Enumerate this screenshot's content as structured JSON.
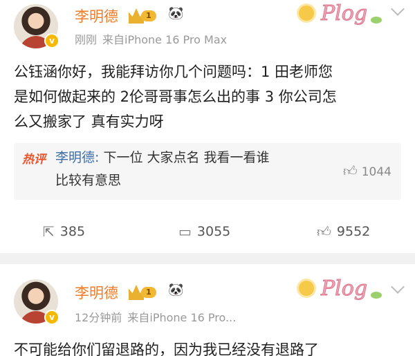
{
  "posts": [
    {
      "username": "李明德",
      "level": "1",
      "badge_icon": "panda-icon",
      "meta_time": "刚刚",
      "meta_source": "来自iPhone 16 Pro Max",
      "decoration": "Plog",
      "content": "公钰涵你好，我能拜访你几个问题吗：1 田老师您\n是如何做起来的 2伦哥哥事怎么出的事 3 你公司怎\n么又搬家了 真有实力呀",
      "hot_comment": {
        "label": "热评",
        "user": "李明德:",
        "text": " 下一位 大家点名 我看一看谁\n比较有意思",
        "likes": "1044"
      },
      "actions": {
        "reposts": "385",
        "comments": "3055",
        "likes": "9552"
      }
    },
    {
      "username": "李明德",
      "level": "1",
      "badge_icon": "panda-icon",
      "meta_time": "12分钟前",
      "meta_source": "来自iPhone 16 Pro...",
      "decoration": "Plog",
      "content": "不可能给你们留退路的，因为我已经没有退路了"
    }
  ],
  "colors": {
    "username": "#f07c2a",
    "hot_label": "#e8552d",
    "link": "#3b6dab",
    "meta": "#999999"
  }
}
